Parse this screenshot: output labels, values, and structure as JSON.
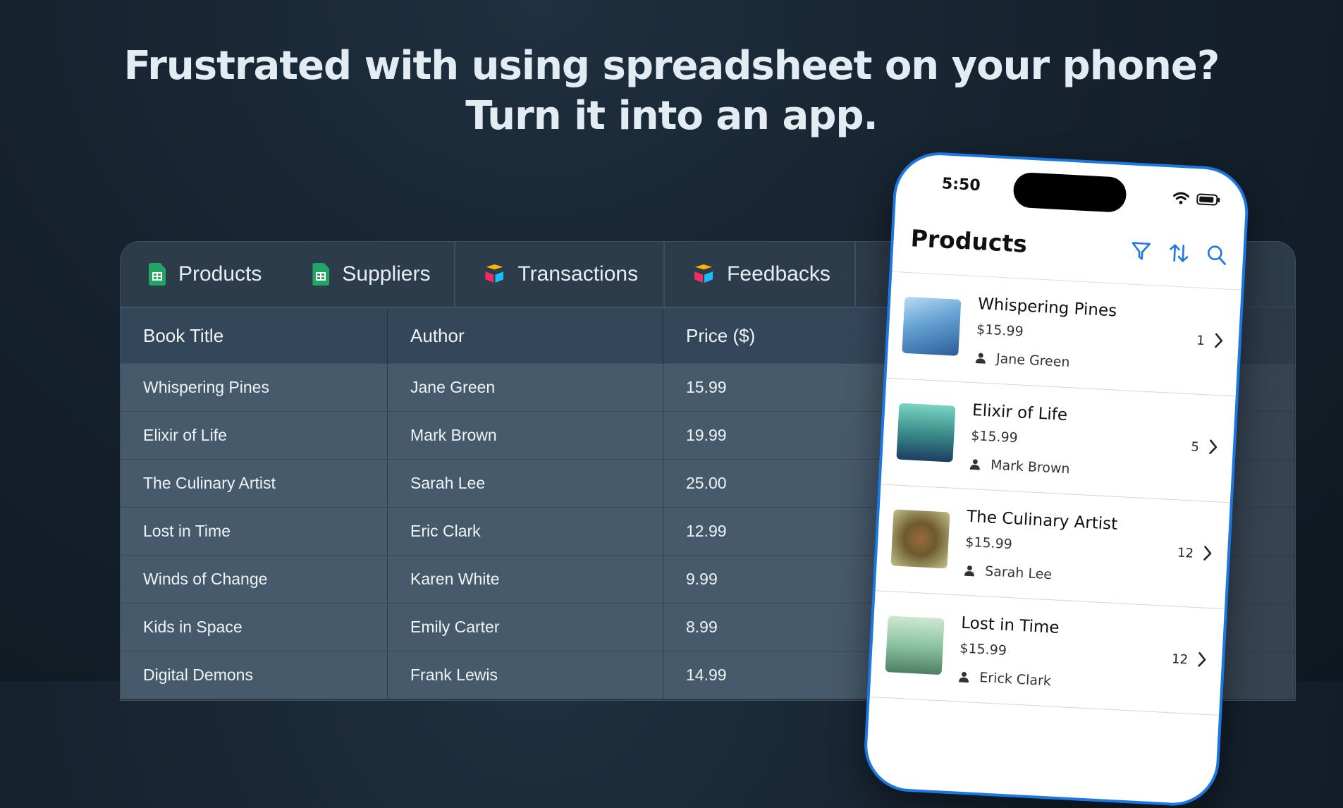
{
  "headline": {
    "line1": "Frustrated with using spreadsheet on your phone?",
    "line2": "Turn it into an app."
  },
  "sheet": {
    "tabs": [
      {
        "label": "Products",
        "icon": "google-sheets-icon"
      },
      {
        "label": "Suppliers",
        "icon": "google-sheets-icon"
      },
      {
        "label": "Transactions",
        "icon": "airtable-icon"
      },
      {
        "label": "Feedbacks",
        "icon": "airtable-icon"
      }
    ],
    "columns": [
      "Book Title",
      "Author",
      "Price ($)"
    ],
    "rows": [
      [
        "Whispering Pines",
        "Jane Green",
        "15.99"
      ],
      [
        "Elixir of Life",
        "Mark Brown",
        "19.99"
      ],
      [
        "The Culinary Artist",
        "Sarah Lee",
        "25.00"
      ],
      [
        "Lost in Time",
        "Eric Clark",
        "12.99"
      ],
      [
        "Winds of Change",
        "Karen White",
        "9.99"
      ],
      [
        "Kids in Space",
        "Emily Carter",
        "8.99"
      ],
      [
        "Digital Demons",
        "Frank Lewis",
        "14.99"
      ]
    ]
  },
  "phone": {
    "time": "5:50",
    "title": "Products",
    "actions": [
      "filter-icon",
      "sort-icon",
      "search-icon"
    ],
    "items": [
      {
        "name": "Whispering Pines",
        "price": "$15.99",
        "author": "Jane Green",
        "count": "1"
      },
      {
        "name": "Elixir of Life",
        "price": "$15.99",
        "author": "Mark Brown",
        "count": "5"
      },
      {
        "name": "The Culinary Artist",
        "price": "$15.99",
        "author": "Sarah Lee",
        "count": "12"
      },
      {
        "name": "Lost in Time",
        "price": "$15.99",
        "author": "Erick Clark",
        "count": "12"
      }
    ],
    "accent": "#1b78e2"
  }
}
